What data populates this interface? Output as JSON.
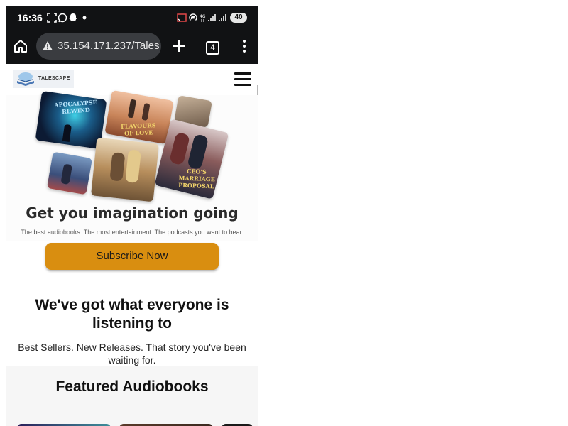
{
  "status_bar": {
    "time": "16:36",
    "battery": "40",
    "icons": [
      "screenshot-icon",
      "whatsapp-icon",
      "snapchat-icon",
      "dot-icon",
      "cast-icon",
      "hotspot-icon",
      "data-4g-icon",
      "signal-icon",
      "signal-icon"
    ]
  },
  "browser": {
    "url": "35.154.171.237/Talesc",
    "tab_count": "4",
    "icons": [
      "home-icon",
      "warning-icon",
      "plus-icon",
      "menu-dots-icon"
    ]
  },
  "header": {
    "logo_text": "TALESCAPE",
    "menu_icon": "hamburger-icon"
  },
  "hero": {
    "covers": [
      {
        "title": "APOCALYPSE REWIND"
      },
      {
        "title": "FLAVOURS OF LOVE"
      },
      {
        "title": ""
      },
      {
        "title": ""
      },
      {
        "title": ""
      },
      {
        "title": "CEO'S MARRIAGE PROPOSAL"
      }
    ],
    "heading": "Get you imagination going",
    "subheading": "The best audiobooks. The most entertainment. The podcasts you want to hear.",
    "cta": "Subscribe Now"
  },
  "section": {
    "title": "We've got what everyone is listening to",
    "subtitle": "Best Sellers. New Releases. That story you've been waiting for."
  },
  "featured": {
    "title": "Featured Audiobooks"
  },
  "colors": {
    "status_bar_bg": "#111214",
    "cta": "#d98e10",
    "url_pill": "#3a3c40"
  }
}
